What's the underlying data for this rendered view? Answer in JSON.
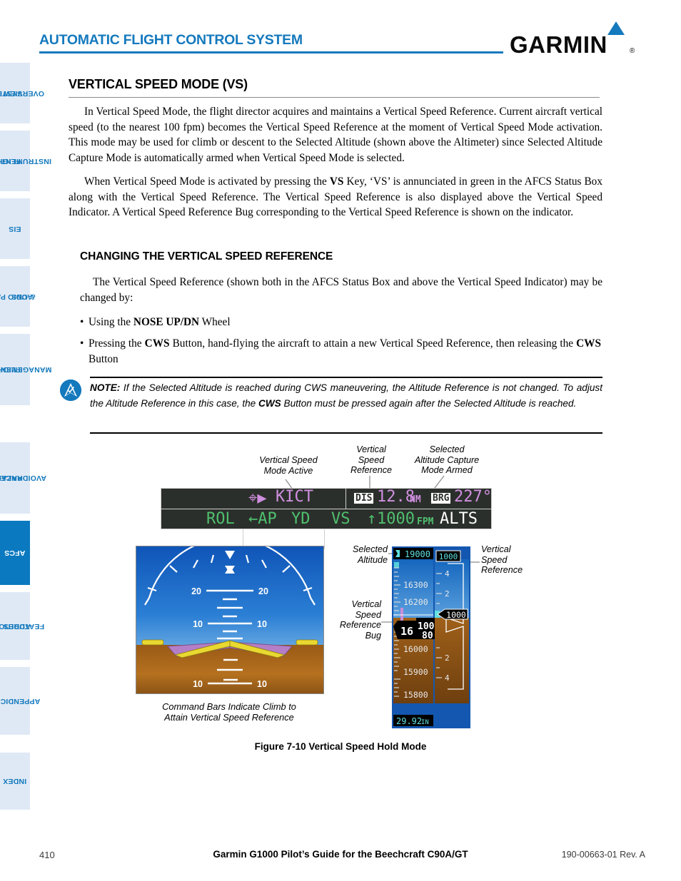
{
  "header": {
    "title": "AUTOMATIC FLIGHT CONTROL SYSTEM",
    "brand": "GARMIN",
    "brand_reg": "®"
  },
  "sidebar": {
    "items": [
      {
        "label": "SYSTEM OVERVIEW",
        "line1": "SYSTEM",
        "line2": "OVERVIEW",
        "active": false
      },
      {
        "label": "FLIGHT INSTRUMENTS",
        "line1": "FLIGHT",
        "line2": "INSTRUMENTS",
        "active": false
      },
      {
        "label": "EIS",
        "line1": "EIS",
        "line2": "",
        "active": false
      },
      {
        "label": "AUDIO PANEL & CNS",
        "line1": "AUDIO PANEL",
        "line2": "& CNS",
        "active": false
      },
      {
        "label": "FLIGHT MANAGEMENT",
        "line1": "FLIGHT",
        "line2": "MANAGEMENT",
        "active": false
      },
      {
        "label": "HAZARD AVOIDANCE",
        "line1": "HAZARD",
        "line2": "AVOIDANCE",
        "active": false
      },
      {
        "label": "AFCS",
        "line1": "AFCS",
        "line2": "",
        "active": true
      },
      {
        "label": "ADDITIONAL FEATURES",
        "line1": "ADDITIONAL",
        "line2": "FEATURES",
        "active": false
      },
      {
        "label": "APPENDICES",
        "line1": "APPENDICES",
        "line2": "",
        "active": false
      },
      {
        "label": "INDEX",
        "line1": "INDEX",
        "line2": "",
        "active": false
      }
    ]
  },
  "main": {
    "section_title": "VERTICAL SPEED MODE (VS)",
    "para1": "In Vertical Speed Mode, the flight director acquires and maintains a Vertical Speed Reference.  Current aircraft vertical speed (to the nearest 100 fpm) becomes the Vertical Speed Reference at the moment of Vertical Speed Mode activation.  This mode may be used for climb or descent to the Selected Altitude (shown above the Altimeter) since Selected Altitude Capture Mode is automatically armed when Vertical Speed Mode is selected.",
    "para2_a": "When Vertical Speed Mode is activated by pressing the ",
    "para2_b": "VS",
    "para2_c": " Key, ‘VS’ is annunciated in green in the AFCS Status Box along with the Vertical Speed Reference.  The Vertical Speed Reference is also displayed above the Vertical Speed Indicator.  A Vertical Speed Reference Bug corresponding to the Vertical Speed Reference is shown on the indicator.",
    "subsection_title": "CHANGING THE VERTICAL SPEED REFERENCE",
    "para3": "The Vertical Speed Reference (shown both in the AFCS Status Box and above the Vertical Speed Indicator) may be changed by:",
    "bullet1_a": "Using the ",
    "bullet1_b": "NOSE UP/DN",
    "bullet1_c": " Wheel",
    "bullet2_a": "Pressing the ",
    "bullet2_b": "CWS",
    "bullet2_c": " Button, hand-flying the aircraft to attain a new Vertical Speed Reference, then releasing the ",
    "bullet2_d": "CWS",
    "bullet2_e": " Button",
    "bullet_dot": "•"
  },
  "note": {
    "label": "NOTE:",
    "text_a": " If the Selected Altitude is reached during CWS maneuvering, the Altitude Reference is not changed. To adjust the Altitude Reference in this case, the ",
    "text_b": "CWS",
    "text_c": " Button must be pressed again after the Selected Altitude is reached."
  },
  "figure": {
    "caption": "Figure 7-10  Vertical Speed Hold Mode",
    "command_bars_caption_l1": "Command Bars Indicate Climb to",
    "command_bars_caption_l2": "Attain Vertical Speed Reference",
    "callouts": {
      "vs_mode_active_l1": "Vertical Speed",
      "vs_mode_active_l2": "Mode Active",
      "vs_reference_top_l1": "Vertical",
      "vs_reference_top_l2": "Speed",
      "vs_reference_top_l3": "Reference",
      "alt_capture_l1": "Selected",
      "alt_capture_l2": "Altitude Capture",
      "alt_capture_l3": "Mode Armed",
      "selected_altitude_l1": "Selected",
      "selected_altitude_l2": "Altitude",
      "vs_ref_bug_l1": "Vertical",
      "vs_ref_bug_l2": "Speed",
      "vs_ref_bug_l3": "Reference",
      "vs_ref_bug_l4": "Bug",
      "vs_reference_right_l1": "Vertical",
      "vs_reference_right_l2": "Speed",
      "vs_reference_right_l3": "Reference"
    },
    "afcs_status_box": {
      "waypoint": "KICT",
      "dis_label": "DIS",
      "dis_value": "12.8",
      "dis_units": "NM",
      "brg_label": "BRG",
      "brg_value": "227°",
      "lateral_mode": "ROL",
      "ap_annunc": "AP",
      "yd_annunc": "YD",
      "vertical_mode": "VS",
      "vs_reference": "1000",
      "vs_units": "FPM",
      "vs_arrow": "↑",
      "armed_mode": "ALTS"
    },
    "pfd": {
      "pitch_up_20": "20",
      "pitch_up_10": "10",
      "pitch_dn_10": "10"
    },
    "tape": {
      "selected_altitude": "19000",
      "alt_label_1": "16300",
      "alt_label_2": "16200",
      "alt_label_3": "16000",
      "alt_label_4": "15900",
      "alt_label_5": "15800",
      "current_alt_thousands": "16",
      "current_alt_hundreds": "1",
      "current_alt_tens_top": "00",
      "current_alt_tens_bot": "80",
      "baro": "29.92",
      "baro_units": "IN",
      "vsi_ref_top": "1000",
      "vsi_bug_value": "1000",
      "vsi_tick_up_4": "4",
      "vsi_tick_up_2": "2",
      "vsi_tick_dn_2": "2",
      "vsi_tick_dn_4": "4"
    }
  },
  "footer": {
    "page_number": "410",
    "doc_title": "Garmin G1000 Pilot’s Guide for the Beechcraft C90A/GT",
    "part_number": "190-00663-01  Rev. A"
  },
  "colors": {
    "brand_blue": "#1479bd",
    "tab_inactive_bg": "#dfe9f5",
    "tab_active_bg": "#0a79c0",
    "pfd_green": "#4fbf6e",
    "pfd_magenta": "#d08fe0",
    "pfd_cyan": "#5fe0e0"
  }
}
